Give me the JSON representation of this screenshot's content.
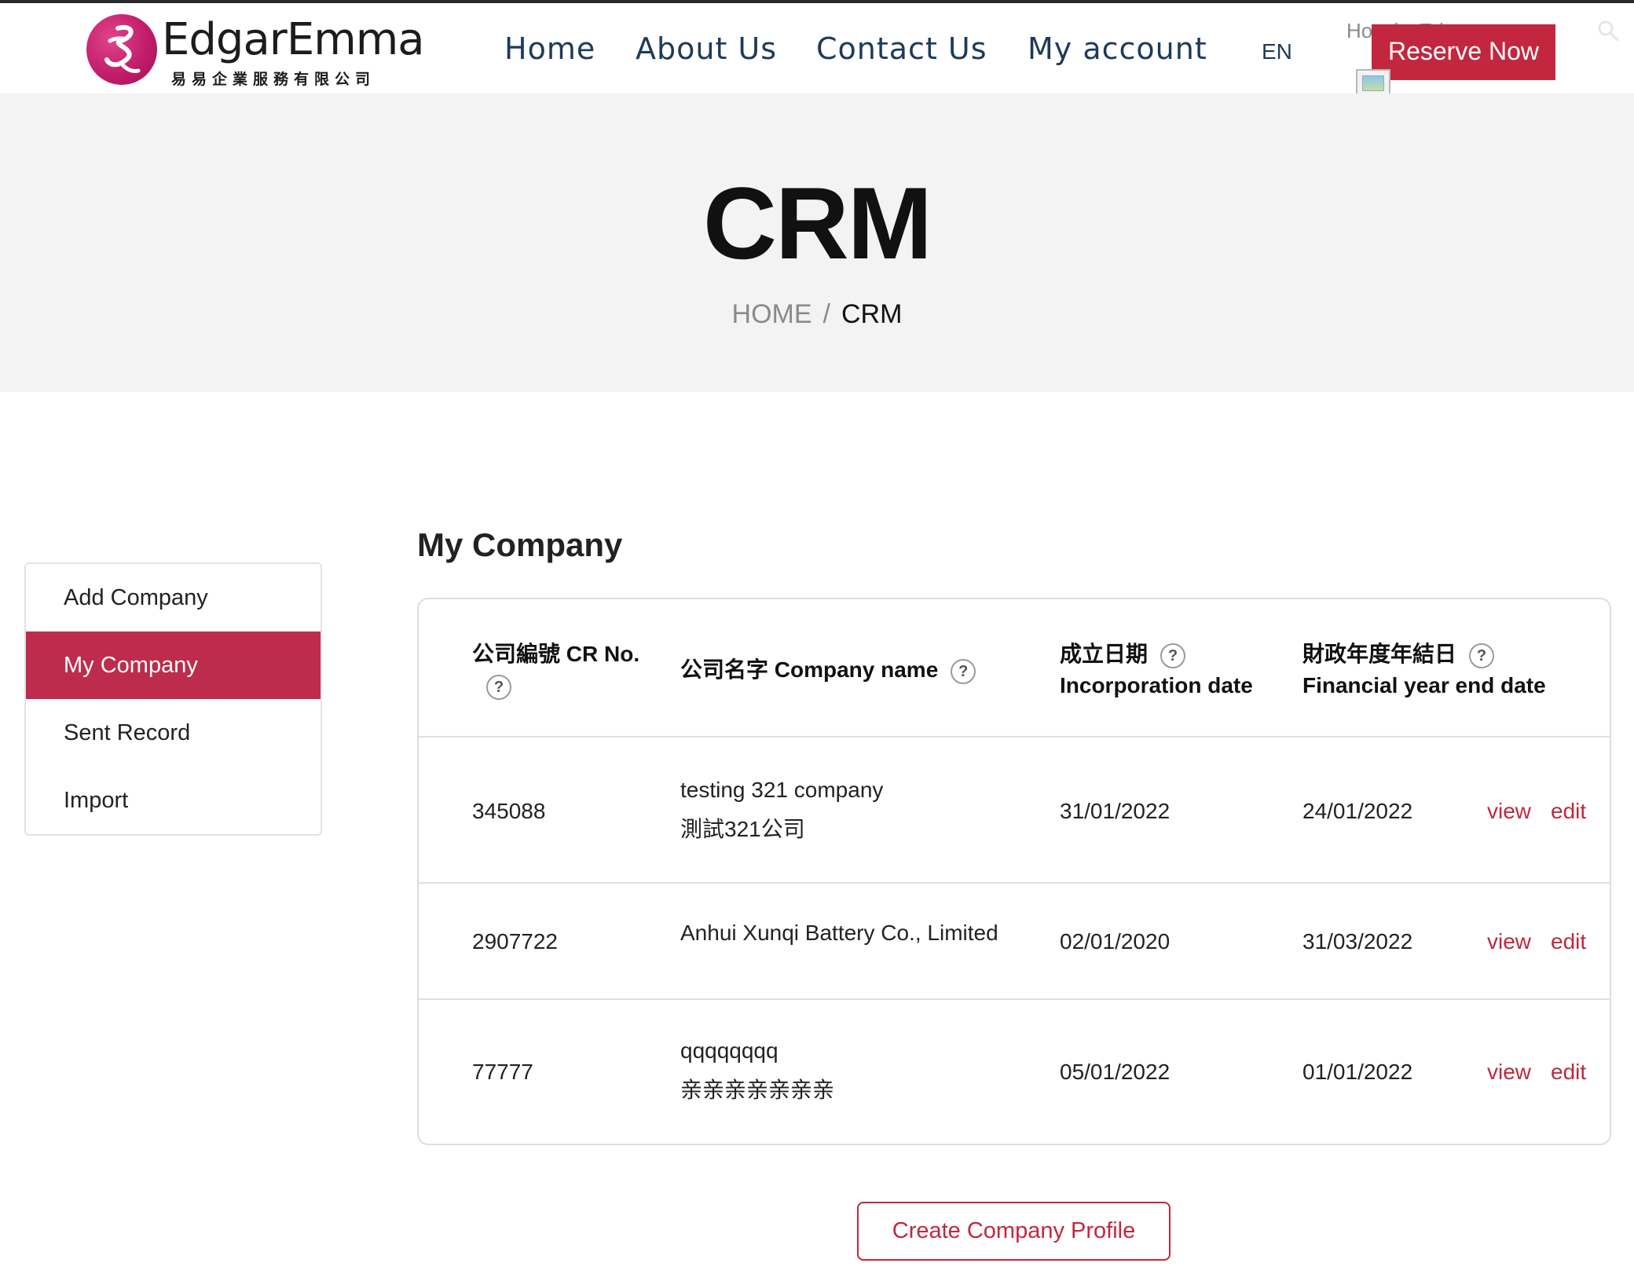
{
  "brand": {
    "name": "EdgarEmma",
    "subtitle": "易易企業服務有限公司",
    "accent_color": "#c2273f"
  },
  "nav": {
    "items": [
      {
        "label": "Home"
      },
      {
        "label": "About Us"
      },
      {
        "label": "Contact Us"
      },
      {
        "label": "My account"
      }
    ],
    "language": "EN",
    "greeting": "Howdy, Edgaremma",
    "reserve_label": "Reserve Now"
  },
  "hero": {
    "title": "CRM",
    "breadcrumb": {
      "home": "HOME",
      "separator": "/",
      "current": "CRM"
    }
  },
  "sidebar": {
    "items": [
      {
        "label": "Add Company",
        "active": false
      },
      {
        "label": "My Company",
        "active": true
      },
      {
        "label": "Sent Record",
        "active": false
      },
      {
        "label": "Import",
        "active": false
      }
    ]
  },
  "main": {
    "title": "My Company",
    "columns": {
      "cr_no": "公司編號 CR No.",
      "company_name": "公司名字 Company name",
      "incorporation_zh": "成立日期",
      "incorporation_en": "Incorporation date",
      "fye_zh": "財政年度年結日",
      "fye_en": "Financial year end date"
    },
    "help_symbol": "?",
    "rows": [
      {
        "cr_no": "345088",
        "name_en": "testing 321 company",
        "name_zh": "測試321公司",
        "incorporation": "31/01/2022",
        "fye": "24/01/2022",
        "view": "view",
        "edit": "edit"
      },
      {
        "cr_no": "2907722",
        "name_en": "Anhui Xunqi Battery Co., Limited",
        "name_zh": "",
        "incorporation": "02/01/2020",
        "fye": "31/03/2022",
        "view": "view",
        "edit": "edit"
      },
      {
        "cr_no": "77777",
        "name_en": "qqqqqqqq",
        "name_zh": "亲亲亲亲亲亲亲",
        "incorporation": "05/01/2022",
        "fye": "01/01/2022",
        "view": "view",
        "edit": "edit"
      }
    ],
    "create_button": "Create Company Profile"
  }
}
